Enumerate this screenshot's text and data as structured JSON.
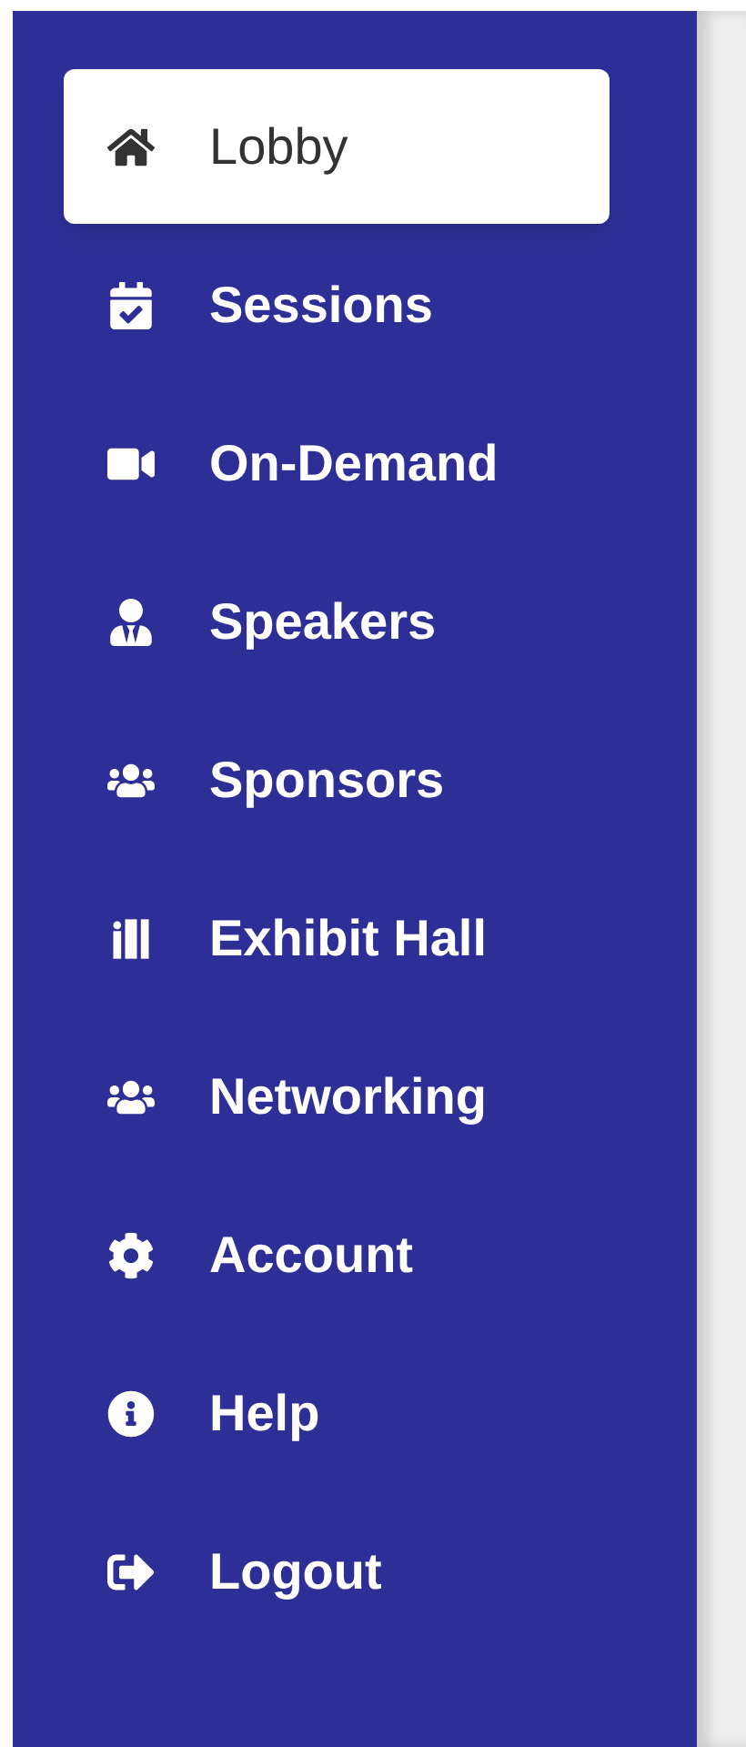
{
  "sidebar": {
    "items": [
      {
        "kind": "home",
        "label": "Lobby",
        "selected": true
      },
      {
        "kind": "calendar",
        "label": "Sessions",
        "selected": false
      },
      {
        "kind": "video",
        "label": "On-Demand",
        "selected": false
      },
      {
        "kind": "speaker",
        "label": "Speakers",
        "selected": false
      },
      {
        "kind": "users",
        "label": "Sponsors",
        "selected": false
      },
      {
        "kind": "hall",
        "label": "Exhibit Hall",
        "selected": false
      },
      {
        "kind": "users",
        "label": "Networking",
        "selected": false
      },
      {
        "kind": "gear",
        "label": "Account",
        "selected": false
      },
      {
        "kind": "info",
        "label": "Help",
        "selected": false
      },
      {
        "kind": "logout",
        "label": "Logout",
        "selected": false
      }
    ]
  }
}
